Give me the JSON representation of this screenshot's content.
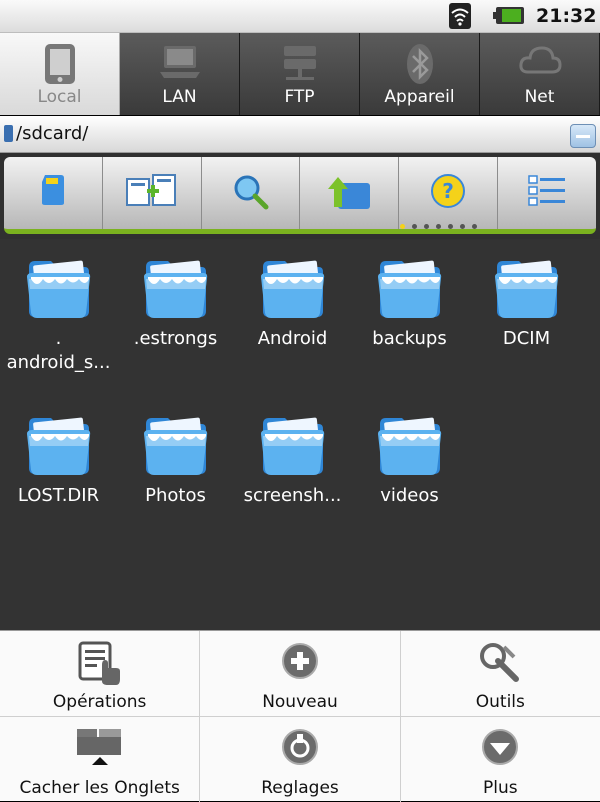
{
  "status_bar": {
    "time": "21:32",
    "icons": [
      "wifi-icon",
      "battery-icon"
    ]
  },
  "tabs": [
    {
      "label": "Local",
      "icon": "tablet-icon",
      "active": true
    },
    {
      "label": "LAN",
      "icon": "laptop-icon",
      "active": false
    },
    {
      "label": "FTP",
      "icon": "server-icon",
      "active": false
    },
    {
      "label": "Appareil",
      "icon": "bluetooth-icon",
      "active": false
    },
    {
      "label": "Net",
      "icon": "cloud-icon",
      "active": false
    }
  ],
  "path": {
    "current": "/sdcard/"
  },
  "toolbar": {
    "items": [
      "sdcard-icon",
      "new-window-icon",
      "search-icon",
      "up-folder-icon",
      "help-icon",
      "list-view-icon"
    ],
    "accent": "#7bb21f",
    "page_indicator": {
      "count": 7,
      "active": 0
    }
  },
  "files": [
    {
      "name": ".\nandroid_s..."
    },
    {
      "name": ".estrongs"
    },
    {
      "name": "Android"
    },
    {
      "name": "backups"
    },
    {
      "name": "DCIM"
    },
    {
      "name": "LOST.DIR"
    },
    {
      "name": "Photos"
    },
    {
      "name": "screensh..."
    },
    {
      "name": "videos"
    }
  ],
  "menu": {
    "operations": "Opérations",
    "nouveau": "Nouveau",
    "outils": "Outils",
    "cacher": "Cacher les Onglets",
    "reglages": "Reglages",
    "plus": "Plus"
  }
}
